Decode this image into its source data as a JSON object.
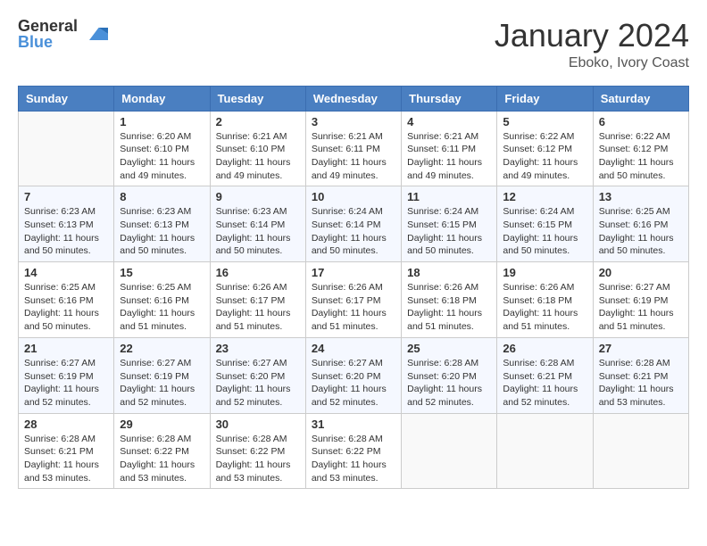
{
  "header": {
    "logo_general": "General",
    "logo_blue": "Blue",
    "month": "January 2024",
    "location": "Eboko, Ivory Coast"
  },
  "days": [
    "Sunday",
    "Monday",
    "Tuesday",
    "Wednesday",
    "Thursday",
    "Friday",
    "Saturday"
  ],
  "weeks": [
    [
      {
        "date": "",
        "sunrise": "",
        "sunset": "",
        "daylight": ""
      },
      {
        "date": "1",
        "sunrise": "Sunrise: 6:20 AM",
        "sunset": "Sunset: 6:10 PM",
        "daylight": "Daylight: 11 hours and 49 minutes."
      },
      {
        "date": "2",
        "sunrise": "Sunrise: 6:21 AM",
        "sunset": "Sunset: 6:10 PM",
        "daylight": "Daylight: 11 hours and 49 minutes."
      },
      {
        "date": "3",
        "sunrise": "Sunrise: 6:21 AM",
        "sunset": "Sunset: 6:11 PM",
        "daylight": "Daylight: 11 hours and 49 minutes."
      },
      {
        "date": "4",
        "sunrise": "Sunrise: 6:21 AM",
        "sunset": "Sunset: 6:11 PM",
        "daylight": "Daylight: 11 hours and 49 minutes."
      },
      {
        "date": "5",
        "sunrise": "Sunrise: 6:22 AM",
        "sunset": "Sunset: 6:12 PM",
        "daylight": "Daylight: 11 hours and 49 minutes."
      },
      {
        "date": "6",
        "sunrise": "Sunrise: 6:22 AM",
        "sunset": "Sunset: 6:12 PM",
        "daylight": "Daylight: 11 hours and 50 minutes."
      }
    ],
    [
      {
        "date": "7",
        "sunrise": "Sunrise: 6:23 AM",
        "sunset": "Sunset: 6:13 PM",
        "daylight": "Daylight: 11 hours and 50 minutes."
      },
      {
        "date": "8",
        "sunrise": "Sunrise: 6:23 AM",
        "sunset": "Sunset: 6:13 PM",
        "daylight": "Daylight: 11 hours and 50 minutes."
      },
      {
        "date": "9",
        "sunrise": "Sunrise: 6:23 AM",
        "sunset": "Sunset: 6:14 PM",
        "daylight": "Daylight: 11 hours and 50 minutes."
      },
      {
        "date": "10",
        "sunrise": "Sunrise: 6:24 AM",
        "sunset": "Sunset: 6:14 PM",
        "daylight": "Daylight: 11 hours and 50 minutes."
      },
      {
        "date": "11",
        "sunrise": "Sunrise: 6:24 AM",
        "sunset": "Sunset: 6:15 PM",
        "daylight": "Daylight: 11 hours and 50 minutes."
      },
      {
        "date": "12",
        "sunrise": "Sunrise: 6:24 AM",
        "sunset": "Sunset: 6:15 PM",
        "daylight": "Daylight: 11 hours and 50 minutes."
      },
      {
        "date": "13",
        "sunrise": "Sunrise: 6:25 AM",
        "sunset": "Sunset: 6:16 PM",
        "daylight": "Daylight: 11 hours and 50 minutes."
      }
    ],
    [
      {
        "date": "14",
        "sunrise": "Sunrise: 6:25 AM",
        "sunset": "Sunset: 6:16 PM",
        "daylight": "Daylight: 11 hours and 50 minutes."
      },
      {
        "date": "15",
        "sunrise": "Sunrise: 6:25 AM",
        "sunset": "Sunset: 6:16 PM",
        "daylight": "Daylight: 11 hours and 51 minutes."
      },
      {
        "date": "16",
        "sunrise": "Sunrise: 6:26 AM",
        "sunset": "Sunset: 6:17 PM",
        "daylight": "Daylight: 11 hours and 51 minutes."
      },
      {
        "date": "17",
        "sunrise": "Sunrise: 6:26 AM",
        "sunset": "Sunset: 6:17 PM",
        "daylight": "Daylight: 11 hours and 51 minutes."
      },
      {
        "date": "18",
        "sunrise": "Sunrise: 6:26 AM",
        "sunset": "Sunset: 6:18 PM",
        "daylight": "Daylight: 11 hours and 51 minutes."
      },
      {
        "date": "19",
        "sunrise": "Sunrise: 6:26 AM",
        "sunset": "Sunset: 6:18 PM",
        "daylight": "Daylight: 11 hours and 51 minutes."
      },
      {
        "date": "20",
        "sunrise": "Sunrise: 6:27 AM",
        "sunset": "Sunset: 6:19 PM",
        "daylight": "Daylight: 11 hours and 51 minutes."
      }
    ],
    [
      {
        "date": "21",
        "sunrise": "Sunrise: 6:27 AM",
        "sunset": "Sunset: 6:19 PM",
        "daylight": "Daylight: 11 hours and 52 minutes."
      },
      {
        "date": "22",
        "sunrise": "Sunrise: 6:27 AM",
        "sunset": "Sunset: 6:19 PM",
        "daylight": "Daylight: 11 hours and 52 minutes."
      },
      {
        "date": "23",
        "sunrise": "Sunrise: 6:27 AM",
        "sunset": "Sunset: 6:20 PM",
        "daylight": "Daylight: 11 hours and 52 minutes."
      },
      {
        "date": "24",
        "sunrise": "Sunrise: 6:27 AM",
        "sunset": "Sunset: 6:20 PM",
        "daylight": "Daylight: 11 hours and 52 minutes."
      },
      {
        "date": "25",
        "sunrise": "Sunrise: 6:28 AM",
        "sunset": "Sunset: 6:20 PM",
        "daylight": "Daylight: 11 hours and 52 minutes."
      },
      {
        "date": "26",
        "sunrise": "Sunrise: 6:28 AM",
        "sunset": "Sunset: 6:21 PM",
        "daylight": "Daylight: 11 hours and 52 minutes."
      },
      {
        "date": "27",
        "sunrise": "Sunrise: 6:28 AM",
        "sunset": "Sunset: 6:21 PM",
        "daylight": "Daylight: 11 hours and 53 minutes."
      }
    ],
    [
      {
        "date": "28",
        "sunrise": "Sunrise: 6:28 AM",
        "sunset": "Sunset: 6:21 PM",
        "daylight": "Daylight: 11 hours and 53 minutes."
      },
      {
        "date": "29",
        "sunrise": "Sunrise: 6:28 AM",
        "sunset": "Sunset: 6:22 PM",
        "daylight": "Daylight: 11 hours and 53 minutes."
      },
      {
        "date": "30",
        "sunrise": "Sunrise: 6:28 AM",
        "sunset": "Sunset: 6:22 PM",
        "daylight": "Daylight: 11 hours and 53 minutes."
      },
      {
        "date": "31",
        "sunrise": "Sunrise: 6:28 AM",
        "sunset": "Sunset: 6:22 PM",
        "daylight": "Daylight: 11 hours and 53 minutes."
      },
      {
        "date": "",
        "sunrise": "",
        "sunset": "",
        "daylight": ""
      },
      {
        "date": "",
        "sunrise": "",
        "sunset": "",
        "daylight": ""
      },
      {
        "date": "",
        "sunrise": "",
        "sunset": "",
        "daylight": ""
      }
    ]
  ]
}
